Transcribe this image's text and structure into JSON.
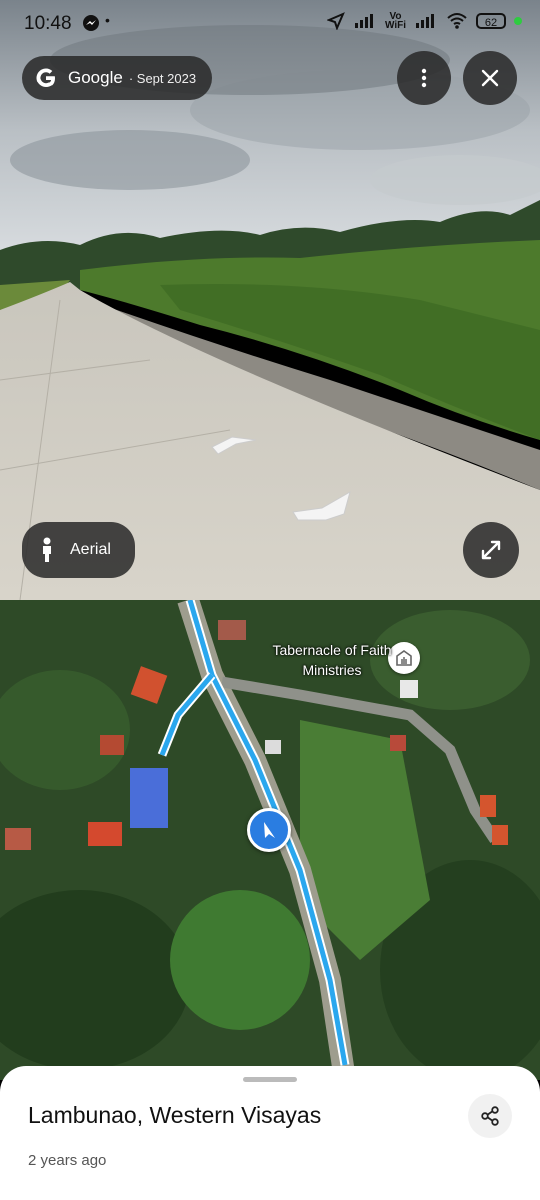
{
  "status_bar": {
    "time": "10:48",
    "carrier_label_top": "Vo",
    "carrier_label_bottom": "WiFi",
    "battery": "62"
  },
  "street_view": {
    "provider": "Google",
    "date": "· Sept 2023",
    "menu_icon": "more-vert-icon",
    "close_icon": "close-icon",
    "mode_button_label": "Aerial",
    "expand_icon": "expand-icon"
  },
  "map": {
    "place_label": "Tabernacle of Faith Ministries"
  },
  "bottom_sheet": {
    "title": "Lambunao, Western Visayas",
    "subtitle": "2 years ago",
    "share_icon": "share-icon"
  },
  "colors": {
    "route": "#2aa7ee",
    "arrow_marker": "#2a7de1",
    "pill_bg": "#282828"
  }
}
